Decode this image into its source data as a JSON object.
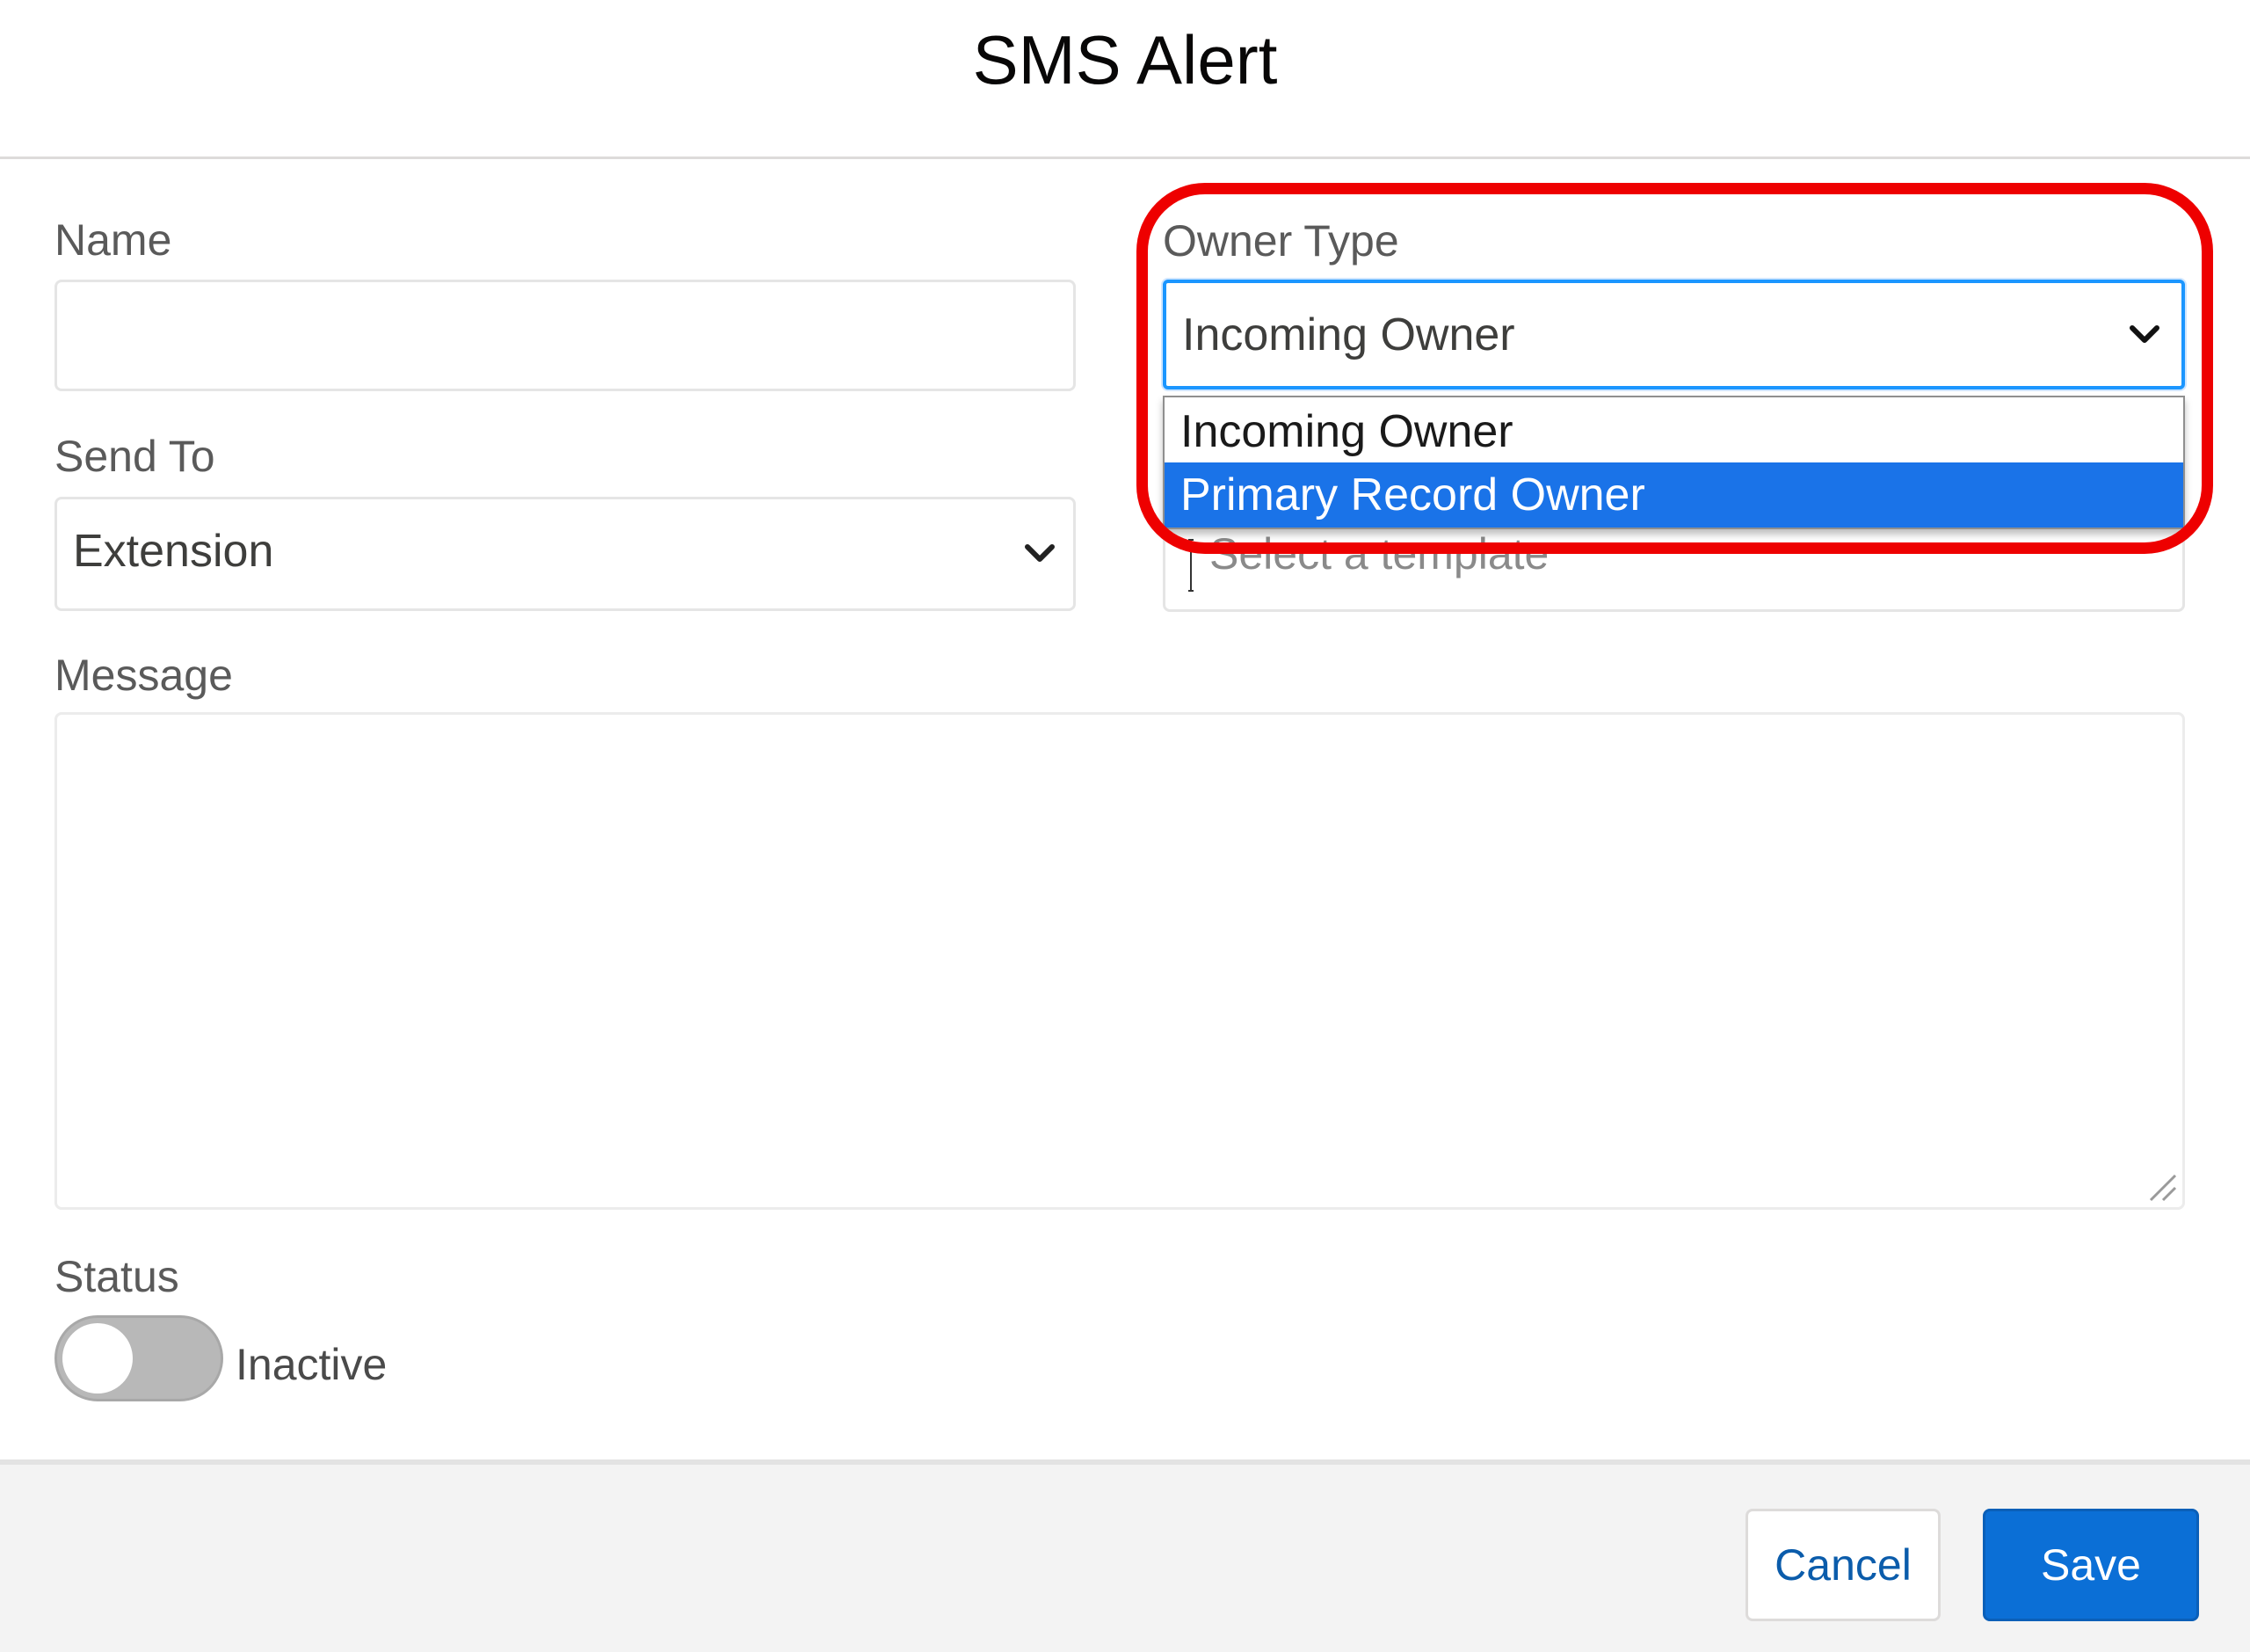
{
  "modal": {
    "title": "SMS Alert"
  },
  "form": {
    "name": {
      "label": "Name",
      "value": ""
    },
    "owner_type": {
      "label": "Owner Type",
      "value": "Incoming Owner",
      "options": [
        "Incoming Owner",
        "Primary Record Owner"
      ],
      "highlighted_option": "Primary Record Owner"
    },
    "send_to": {
      "label": "Send To",
      "value": "Extension"
    },
    "template": {
      "placeholder": "Select a template"
    },
    "message": {
      "label": "Message",
      "value": ""
    },
    "status": {
      "label": "Status",
      "toggle_text": "Inactive",
      "active": false
    }
  },
  "footer": {
    "cancel_label": "Cancel",
    "save_label": "Save"
  },
  "colors": {
    "accent": "#0b6fd6",
    "highlight_option": "#1a73e8",
    "annotation_ring": "#ee0000"
  },
  "icons": {
    "select_chevron": "chevron-down-icon",
    "text_cursor": "text-cursor-icon",
    "resize_grip": "resize-grip-icon"
  }
}
